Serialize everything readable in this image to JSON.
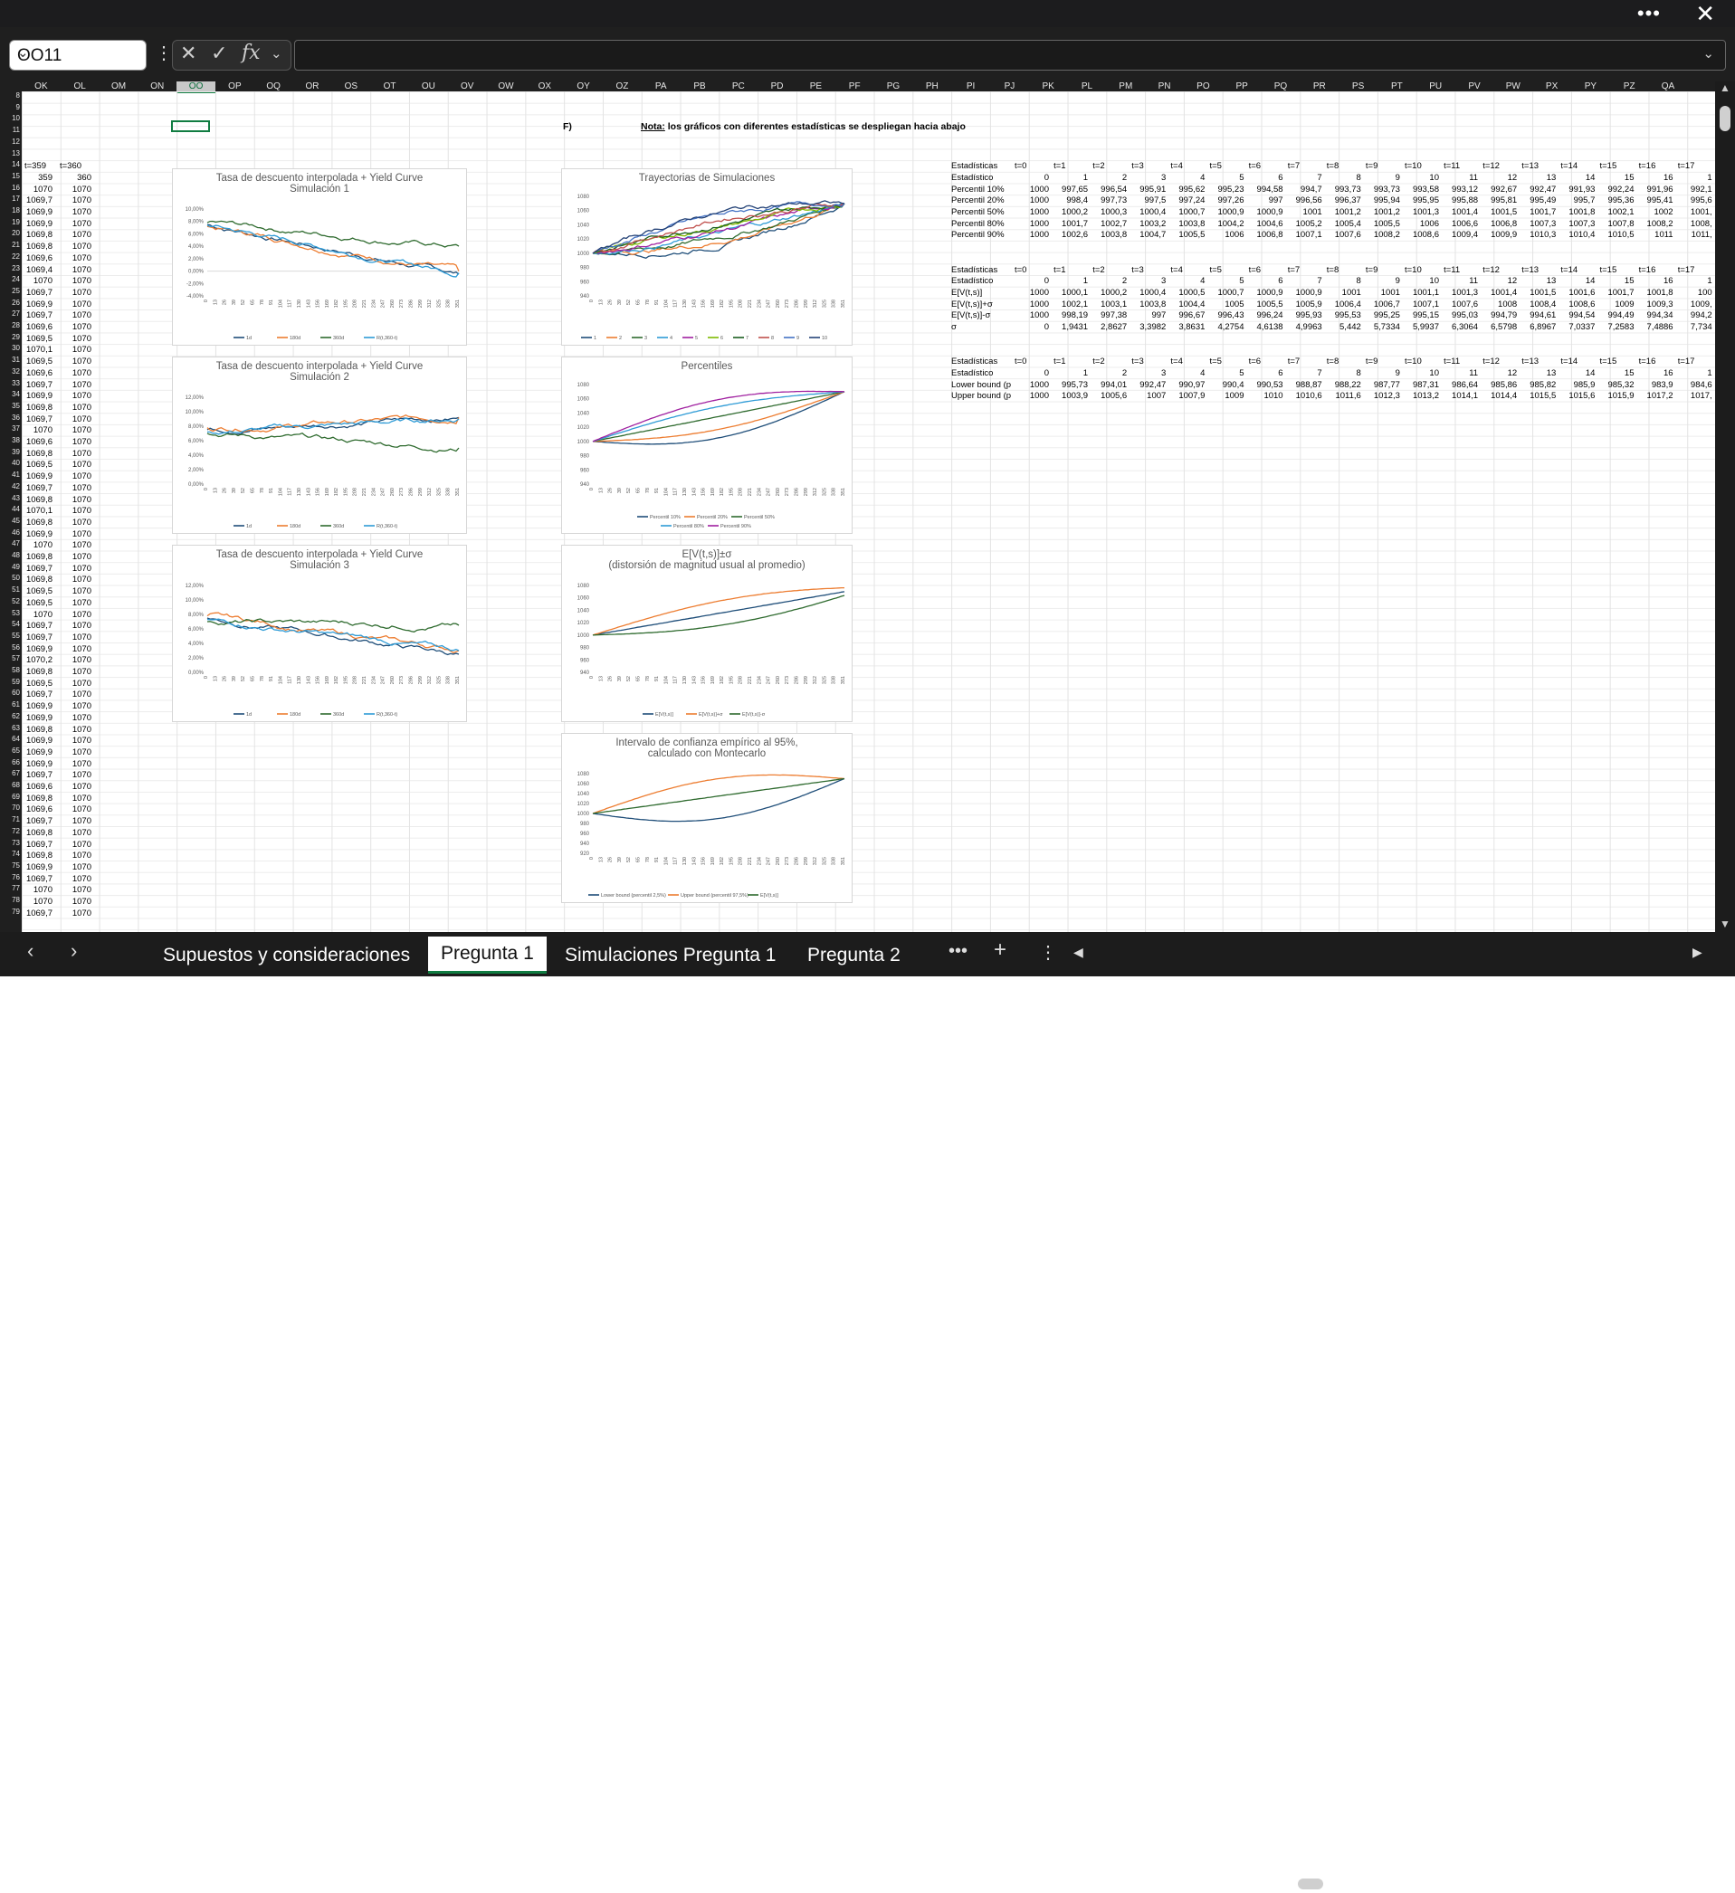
{
  "window": {
    "more_label": "•••",
    "close_label": "✕"
  },
  "formula_bar": {
    "name_box": "OO11",
    "fx_label": "fx",
    "value": ""
  },
  "columns": [
    "OK",
    "OL",
    "OM",
    "ON",
    "OO",
    "OP",
    "OQ",
    "OR",
    "OS",
    "OT",
    "OU",
    "OV",
    "OW",
    "OX",
    "OY",
    "OZ",
    "PA",
    "PB",
    "PC",
    "PD",
    "PE",
    "PF",
    "PG",
    "PH",
    "PI",
    "PJ",
    "PK",
    "PL",
    "PM",
    "PN",
    "PO",
    "PP",
    "PQ",
    "PR",
    "PS",
    "PT",
    "PU",
    "PV",
    "PW",
    "PX",
    "PY",
    "PZ",
    "QA"
  ],
  "rows": [
    "8",
    "9",
    "10",
    "11",
    "12",
    "13",
    "14",
    "15",
    "16",
    "17",
    "18",
    "19",
    "20",
    "21",
    "22",
    "23",
    "24",
    "25",
    "26",
    "27",
    "28",
    "29",
    "30",
    "31",
    "32",
    "33",
    "34",
    "35",
    "36",
    "37",
    "38",
    "39",
    "40",
    "41",
    "42",
    "43",
    "44",
    "45",
    "46",
    "47",
    "48",
    "49",
    "50",
    "51",
    "52",
    "53",
    "54",
    "55",
    "56",
    "57",
    "58",
    "59",
    "60",
    "61",
    "62",
    "63",
    "64",
    "65",
    "66",
    "67",
    "68",
    "69",
    "70",
    "71",
    "72",
    "73",
    "74",
    "75",
    "76",
    "77",
    "78",
    "79"
  ],
  "left_cols": {
    "header": [
      "t=359",
      "t=360"
    ],
    "ok": [
      "359",
      "1070",
      "1069,7",
      "1069,9",
      "1069,9",
      "1069,8",
      "1069,8",
      "1069,6",
      "1069,4",
      "1070",
      "1069,7",
      "1069,9",
      "1069,7",
      "1069,6",
      "1069,5",
      "1070,1",
      "1069,5",
      "1069,6",
      "1069,7",
      "1069,9",
      "1069,8",
      "1069,7",
      "1070",
      "1069,6",
      "1069,8",
      "1069,5",
      "1069,9",
      "1069,7",
      "1069,8",
      "1070,1",
      "1069,8",
      "1069,9",
      "1070",
      "1069,8",
      "1069,7",
      "1069,8",
      "1069,5",
      "1069,5",
      "1070",
      "1069,7",
      "1069,7",
      "1069,9",
      "1070,2",
      "1069,8",
      "1069,5",
      "1069,7",
      "1069,9",
      "1069,9",
      "1069,8",
      "1069,9",
      "1069,9",
      "1069,9",
      "1069,7",
      "1069,6",
      "1069,8",
      "1069,6",
      "1069,7",
      "1069,8",
      "1069,7",
      "1069,8",
      "1069,9",
      "1069,7",
      "1070",
      "1070",
      "1069,7"
    ],
    "ol": [
      "360",
      "1070",
      "1070",
      "1070",
      "1070",
      "1070",
      "1070",
      "1070",
      "1070",
      "1070",
      "1070",
      "1070",
      "1070",
      "1070",
      "1070",
      "1070",
      "1070",
      "1070",
      "1070",
      "1070",
      "1070",
      "1070",
      "1070",
      "1070",
      "1070",
      "1070",
      "1070",
      "1070",
      "1070",
      "1070",
      "1070",
      "1070",
      "1070",
      "1070",
      "1070",
      "1070",
      "1070",
      "1070",
      "1070",
      "1070",
      "1070",
      "1070",
      "1070",
      "1070",
      "1070",
      "1070",
      "1070",
      "1070",
      "1070",
      "1070",
      "1070",
      "1070",
      "1070",
      "1070",
      "1070",
      "1070",
      "1070",
      "1070",
      "1070",
      "1070",
      "1070",
      "1070",
      "1070",
      "1070",
      "1070"
    ]
  },
  "section": {
    "label": "F)",
    "note_bold": "Nota:",
    "note_rest": "los gráficos con diferentes estadísticas se despliegan hacia abajo"
  },
  "table1": {
    "header": [
      "Estadísticas",
      "t=0",
      "t=1",
      "t=2",
      "t=3",
      "t=4",
      "t=5",
      "t=6",
      "t=7",
      "t=8",
      "t=9",
      "t=10",
      "t=11",
      "t=12",
      "t=13",
      "t=14",
      "t=15",
      "t=16",
      "t=17"
    ],
    "rows": [
      [
        "Estadístico",
        "0",
        "1",
        "2",
        "3",
        "4",
        "5",
        "6",
        "7",
        "8",
        "9",
        "10",
        "11",
        "12",
        "13",
        "14",
        "15",
        "16",
        "1"
      ],
      [
        "Percentil 10%",
        "1000",
        "997,65",
        "996,54",
        "995,91",
        "995,62",
        "995,23",
        "994,58",
        "994,7",
        "993,73",
        "993,73",
        "993,58",
        "993,12",
        "992,67",
        "992,47",
        "991,93",
        "992,24",
        "991,96",
        "992,1"
      ],
      [
        "Percentil 20%",
        "1000",
        "998,4",
        "997,73",
        "997,5",
        "997,24",
        "997,26",
        "997",
        "996,56",
        "996,37",
        "995,94",
        "995,95",
        "995,88",
        "995,81",
        "995,49",
        "995,7",
        "995,36",
        "995,41",
        "995,6"
      ],
      [
        "Percentil 50%",
        "1000",
        "1000,2",
        "1000,3",
        "1000,4",
        "1000,7",
        "1000,9",
        "1000,9",
        "1001",
        "1001,2",
        "1001,2",
        "1001,3",
        "1001,4",
        "1001,5",
        "1001,7",
        "1001,8",
        "1002,1",
        "1002",
        "1001,"
      ],
      [
        "Percentil 80%",
        "1000",
        "1001,7",
        "1002,7",
        "1003,2",
        "1003,8",
        "1004,2",
        "1004,6",
        "1005,2",
        "1005,4",
        "1005,5",
        "1006",
        "1006,6",
        "1006,8",
        "1007,3",
        "1007,3",
        "1007,8",
        "1008,2",
        "1008,"
      ],
      [
        "Percentil 90%",
        "1000",
        "1002,6",
        "1003,8",
        "1004,7",
        "1005,5",
        "1006",
        "1006,8",
        "1007,1",
        "1007,6",
        "1008,2",
        "1008,6",
        "1009,4",
        "1009,9",
        "1010,3",
        "1010,4",
        "1010,5",
        "1011",
        "1011,"
      ]
    ]
  },
  "table2": {
    "header": [
      "Estadísticas",
      "t=0",
      "t=1",
      "t=2",
      "t=3",
      "t=4",
      "t=5",
      "t=6",
      "t=7",
      "t=8",
      "t=9",
      "t=10",
      "t=11",
      "t=12",
      "t=13",
      "t=14",
      "t=15",
      "t=16",
      "t=17"
    ],
    "rows": [
      [
        "Estadístico",
        "0",
        "1",
        "2",
        "3",
        "4",
        "5",
        "6",
        "7",
        "8",
        "9",
        "10",
        "11",
        "12",
        "13",
        "14",
        "15",
        "16",
        "1"
      ],
      [
        "E[V(t,s)]",
        "1000",
        "1000,1",
        "1000,2",
        "1000,4",
        "1000,5",
        "1000,7",
        "1000,9",
        "1000,9",
        "1001",
        "1001",
        "1001,1",
        "1001,3",
        "1001,4",
        "1001,5",
        "1001,6",
        "1001,7",
        "1001,8",
        "100"
      ],
      [
        "E[V(t,s)]+σ",
        "1000",
        "1002,1",
        "1003,1",
        "1003,8",
        "1004,4",
        "1005",
        "1005,5",
        "1005,9",
        "1006,4",
        "1006,7",
        "1007,1",
        "1007,6",
        "1008",
        "1008,4",
        "1008,6",
        "1009",
        "1009,3",
        "1009,"
      ],
      [
        "E[V(t,s)]-σ",
        "1000",
        "998,19",
        "997,38",
        "997",
        "996,67",
        "996,43",
        "996,24",
        "995,93",
        "995,53",
        "995,25",
        "995,15",
        "995,03",
        "994,79",
        "994,61",
        "994,54",
        "994,49",
        "994,34",
        "994,2"
      ],
      [
        "σ",
        "0",
        "1,9431",
        "2,8627",
        "3,3982",
        "3,8631",
        "4,2754",
        "4,6138",
        "4,9963",
        "5,442",
        "5,7334",
        "5,9937",
        "6,3064",
        "6,5798",
        "6,8967",
        "7,0337",
        "7,2583",
        "7,4886",
        "7,734"
      ]
    ]
  },
  "table3": {
    "header": [
      "Estadísticas",
      "t=0",
      "t=1",
      "t=2",
      "t=3",
      "t=4",
      "t=5",
      "t=6",
      "t=7",
      "t=8",
      "t=9",
      "t=10",
      "t=11",
      "t=12",
      "t=13",
      "t=14",
      "t=15",
      "t=16",
      "t=17"
    ],
    "rows": [
      [
        "Estadístico",
        "0",
        "1",
        "2",
        "3",
        "4",
        "5",
        "6",
        "7",
        "8",
        "9",
        "10",
        "11",
        "12",
        "13",
        "14",
        "15",
        "16",
        "1"
      ],
      [
        "Lower bound (p",
        "1000",
        "995,73",
        "994,01",
        "992,47",
        "990,97",
        "990,4",
        "990,53",
        "988,87",
        "988,22",
        "987,77",
        "987,31",
        "986,64",
        "985,86",
        "985,82",
        "985,9",
        "985,32",
        "983,9",
        "984,6"
      ],
      [
        "Upper bound (p",
        "1000",
        "1003,9",
        "1005,6",
        "1007",
        "1007,9",
        "1009",
        "1010",
        "1010,6",
        "1011,6",
        "1012,3",
        "1013,2",
        "1014,1",
        "1014,4",
        "1015,5",
        "1015,6",
        "1015,9",
        "1017,2",
        "1017,"
      ]
    ]
  },
  "x_ticks": [
    "0",
    "13",
    "26",
    "39",
    "52",
    "65",
    "78",
    "91",
    "104",
    "117",
    "130",
    "143",
    "156",
    "169",
    "182",
    "195",
    "208",
    "221",
    "234",
    "247",
    "260",
    "273",
    "286",
    "299",
    "312",
    "325",
    "338",
    "351"
  ],
  "colors": {
    "c1": "#1f4e79",
    "c2": "#ed7d31",
    "c3": "#2f6b2f",
    "c4": "#2e9bd6",
    "c5": "#a020a0",
    "c6": "#7fba00",
    "c7": "#1b5e20",
    "c8": "#c0504d",
    "c9": "#4472c4",
    "c10": "#264478"
  },
  "chart_data": [
    {
      "type": "line",
      "title": "Tasa de descuento interpolada + Yield Curve",
      "subtitle": "Simulación 1",
      "yticks": [
        "10,00%",
        "8,00%",
        "6,00%",
        "4,00%",
        "2,00%",
        "0,00%",
        "-2,00%",
        "-4,00%"
      ],
      "ylim": [
        -4,
        10
      ],
      "legend": [
        "1d",
        "180d",
        "360d",
        "R(t,360-t)"
      ],
      "series": [
        {
          "name": "1d",
          "start": 7.5,
          "end": -0.5
        },
        {
          "name": "180d",
          "start": 7.2,
          "end": 0
        },
        {
          "name": "360d",
          "start": 7.8,
          "end": 4
        },
        {
          "name": "R(t,360-t)",
          "start": 7.4,
          "end": -0.3
        }
      ]
    },
    {
      "type": "line",
      "title": "Tasa de descuento interpolada + Yield Curve",
      "subtitle": "Simulación 2",
      "yticks": [
        "12,00%",
        "10,00%",
        "8,00%",
        "6,00%",
        "4,00%",
        "2,00%",
        "0,00%"
      ],
      "ylim": [
        0,
        12
      ],
      "legend": [
        "1d",
        "180d",
        "360d",
        "R(t,360-t)"
      ],
      "series": [
        {
          "name": "1d",
          "start": 7.5,
          "end": 9.2
        },
        {
          "name": "180d",
          "start": 7.8,
          "end": 9.2
        },
        {
          "name": "360d",
          "start": 7,
          "end": 5
        },
        {
          "name": "R(t,360-t)",
          "start": 7.2,
          "end": 9
        }
      ]
    },
    {
      "type": "line",
      "title": "Tasa de descuento interpolada + Yield Curve",
      "subtitle": "Simulación 3",
      "yticks": [
        "12,00%",
        "10,00%",
        "8,00%",
        "6,00%",
        "4,00%",
        "2,00%",
        "0,00%"
      ],
      "ylim": [
        0,
        12
      ],
      "legend": [
        "1d",
        "180d",
        "360d",
        "R(t,360-t)"
      ],
      "series": [
        {
          "name": "1d",
          "start": 7.5,
          "end": 2.5
        },
        {
          "name": "180d",
          "start": 7.8,
          "end": 3
        },
        {
          "name": "360d",
          "start": 7,
          "end": 6.5
        },
        {
          "name": "R(t,360-t)",
          "start": 7.3,
          "end": 3
        }
      ]
    },
    {
      "type": "line",
      "title": "Trayectorias de Simulaciones",
      "yticks": [
        "1080",
        "1060",
        "1040",
        "1020",
        "1000",
        "980",
        "960",
        "940"
      ],
      "ylim": [
        940,
        1080
      ],
      "legend": [
        "1",
        "2",
        "3",
        "4",
        "5",
        "6",
        "7",
        "8",
        "9",
        "10"
      ],
      "series": [
        {
          "name": "1",
          "start": 1000,
          "end": 1070
        },
        {
          "name": "2",
          "start": 1000,
          "end": 1070
        },
        {
          "name": "3",
          "start": 1000,
          "end": 1070
        },
        {
          "name": "4",
          "start": 1000,
          "end": 1070
        },
        {
          "name": "5",
          "start": 1000,
          "end": 1070
        },
        {
          "name": "6",
          "start": 1000,
          "end": 1070
        },
        {
          "name": "7",
          "start": 1000,
          "end": 1070
        },
        {
          "name": "8",
          "start": 1000,
          "end": 1070
        },
        {
          "name": "9",
          "start": 1000,
          "end": 1070
        },
        {
          "name": "10",
          "start": 1000,
          "end": 1070
        }
      ]
    },
    {
      "type": "line",
      "title": "Percentiles",
      "yticks": [
        "1080",
        "1060",
        "1040",
        "1020",
        "1000",
        "980",
        "960",
        "940"
      ],
      "ylim": [
        940,
        1080
      ],
      "legend": [
        "Percentil 10%",
        "Percentil 20%",
        "Percentil 50%",
        "Percentil 80%",
        "Percentil 90%"
      ],
      "series": [
        {
          "name": "Percentil 10%",
          "start": 1000,
          "end": 1070
        },
        {
          "name": "Percentil 20%",
          "start": 1000,
          "end": 1070
        },
        {
          "name": "Percentil 50%",
          "start": 1000,
          "end": 1070
        },
        {
          "name": "Percentil 80%",
          "start": 1000,
          "end": 1070
        },
        {
          "name": "Percentil 90%",
          "start": 1000,
          "end": 1070
        }
      ]
    },
    {
      "type": "line",
      "title": "E[V(t,s)]±σ",
      "subtitle": "(distorsión de magnitud usual al promedio)",
      "yticks": [
        "1080",
        "1060",
        "1040",
        "1020",
        "1000",
        "980",
        "960",
        "940"
      ],
      "ylim": [
        940,
        1080
      ],
      "legend": [
        "E[V(t,s)]",
        "E[V(t,s)]+σ",
        "E[V(t,s)]-σ"
      ],
      "series": [
        {
          "name": "E[V(t,s)]",
          "start": 1000,
          "end": 1070
        },
        {
          "name": "E[V(t,s)]+σ",
          "start": 1000,
          "end": 1070
        },
        {
          "name": "E[V(t,s)]-σ",
          "start": 1000,
          "end": 1070
        }
      ]
    },
    {
      "type": "line",
      "title": "Intervalo de confianza empírico al 95%,",
      "subtitle": "calculado con Montecarlo",
      "yticks": [
        "1080",
        "1060",
        "1040",
        "1020",
        "1000",
        "980",
        "960",
        "940",
        "920"
      ],
      "ylim": [
        920,
        1080
      ],
      "legend": [
        "Lower bound (percentil 2,5%)",
        "Upper bound (percentil 97,5%)",
        "E[V(t,s)]"
      ],
      "series": [
        {
          "name": "Lower bound (percentil 2,5%)",
          "start": 1000,
          "end": 1070
        },
        {
          "name": "Upper bound (percentil 97,5%)",
          "start": 1000,
          "end": 1070
        },
        {
          "name": "E[V(t,s)]",
          "start": 1000,
          "end": 1070
        }
      ]
    }
  ],
  "tabs": [
    "Supuestos y consideraciones",
    "Pregunta 1",
    "Simulaciones Pregunta 1",
    "Pregunta 2"
  ],
  "tabbar_icons": {
    "more": "•••",
    "add": "+",
    "menu": "⋮"
  }
}
